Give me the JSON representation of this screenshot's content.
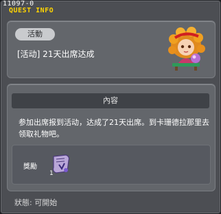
{
  "window": {
    "quest_id": "11097-0",
    "title": "QUEST INFO"
  },
  "quest": {
    "category": "活動",
    "title": "[活动] 21天出席达成",
    "npc_icon": "npc-portrait-icon"
  },
  "content": {
    "header": "內容",
    "description": "参加出席报到活动，达成了21天出席。到卡珊德拉那里去领取礼物吧。"
  },
  "reward": {
    "label": "獎勵",
    "item_icon": "scroll-item-icon",
    "quantity": "1"
  },
  "status": {
    "text": "狀態: 可開始"
  },
  "colors": {
    "title_yellow": "#ffd400",
    "panel_bg": "#63666b",
    "window_bg": "#4c4e53",
    "badge_bg": "#c9cbce"
  }
}
